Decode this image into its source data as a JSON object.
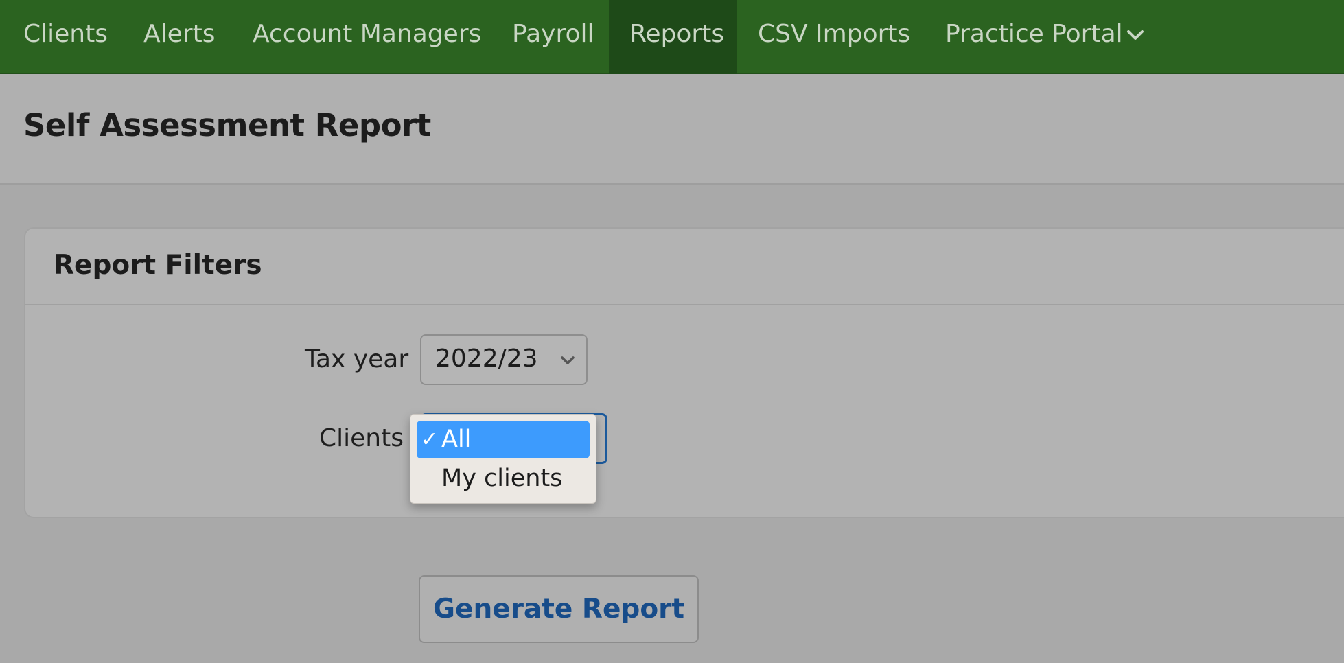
{
  "nav": {
    "items": [
      {
        "label": "Clients"
      },
      {
        "label": "Alerts"
      },
      {
        "label": "Account Managers"
      },
      {
        "label": "Payroll"
      },
      {
        "label": "Reports",
        "active": true
      },
      {
        "label": "CSV Imports"
      },
      {
        "label": "Practice Portal",
        "icon": "chevron-down-icon"
      }
    ]
  },
  "page": {
    "title": "Self Assessment Report"
  },
  "filters": {
    "title": "Report Filters",
    "tax_year": {
      "label": "Tax year",
      "value": "2022/23"
    },
    "clients": {
      "label": "Clients",
      "options": [
        {
          "label": "All",
          "selected": true,
          "check": "✓"
        },
        {
          "label": "My clients",
          "selected": false
        }
      ]
    }
  },
  "actions": {
    "generate_label": "Generate Report"
  },
  "colors": {
    "nav_bg": "#2b6320",
    "nav_active_bg": "#1e4a18",
    "selected_option_bg": "#3d9bfd",
    "button_text": "#174c8a",
    "focus_border": "#1c5a9c"
  }
}
